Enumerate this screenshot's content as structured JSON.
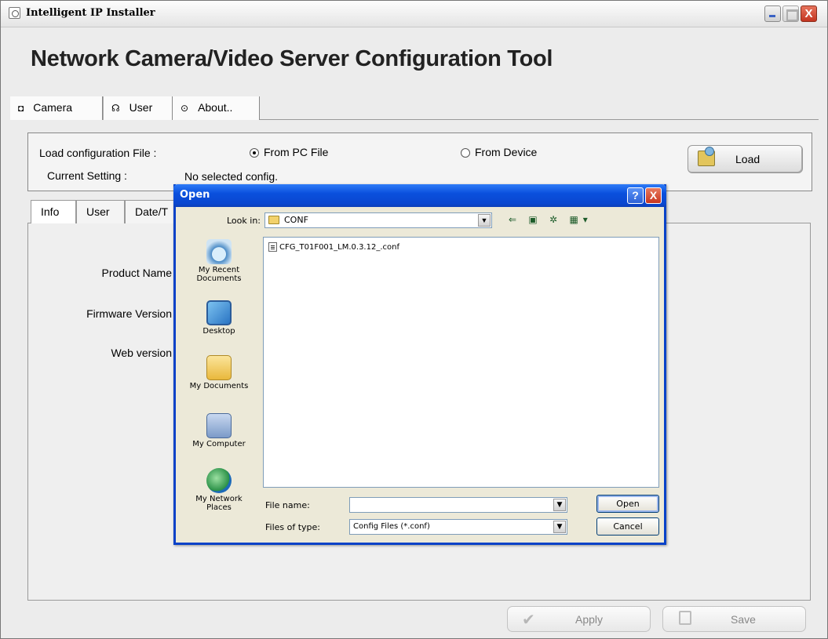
{
  "window": {
    "title": "Intelligent IP Installer",
    "close_glyph": "X"
  },
  "heading": "Network Camera/Video Server Configuration Tool",
  "main_tabs": [
    {
      "label": "Camera",
      "icon": "camera-icon"
    },
    {
      "label": "User",
      "icon": "user-icon"
    },
    {
      "label": "About..",
      "icon": "info-icon"
    }
  ],
  "load": {
    "file_label": "Load configuration File :",
    "from_pc": "From PC File",
    "from_device": "From Device",
    "from_pc_selected": true,
    "current_label": "Current Setting :",
    "current_value": "No selected config.",
    "load_button": "Load"
  },
  "sub_tabs": [
    {
      "label": "Info"
    },
    {
      "label": "User"
    },
    {
      "label": "Date/T"
    }
  ],
  "info_fields": {
    "product_name": "Product Name",
    "firmware_version": "Firmware Version",
    "web_version": "Web version"
  },
  "bottom": {
    "apply": "Apply",
    "save": "Save"
  },
  "dialog": {
    "title": "Open",
    "help_glyph": "?",
    "close_glyph": "X",
    "look_in_label": "Look in:",
    "look_in_value": "CONF",
    "toolbar_glyphs": "⇐ ▣ ✲ ▦▾",
    "places": [
      {
        "label": "My Recent Documents",
        "icon": "recent-documents-icon"
      },
      {
        "label": "Desktop",
        "icon": "desktop-icon"
      },
      {
        "label": "My Documents",
        "icon": "my-documents-icon"
      },
      {
        "label": "My Computer",
        "icon": "my-computer-icon"
      },
      {
        "label": "My Network Places",
        "icon": "network-places-icon"
      }
    ],
    "files": [
      "CFG_T01F001_LM.0.3.12_.conf"
    ],
    "file_name_label": "File name:",
    "file_name_value": "",
    "files_of_type_label": "Files of type:",
    "files_of_type_value": "Config Files (*.conf)",
    "open_button": "Open",
    "cancel_button": "Cancel"
  },
  "colors": {
    "xp_title_blue": "#0a50dd",
    "dialog_face": "#ece9d8",
    "close_red": "#c33420"
  }
}
